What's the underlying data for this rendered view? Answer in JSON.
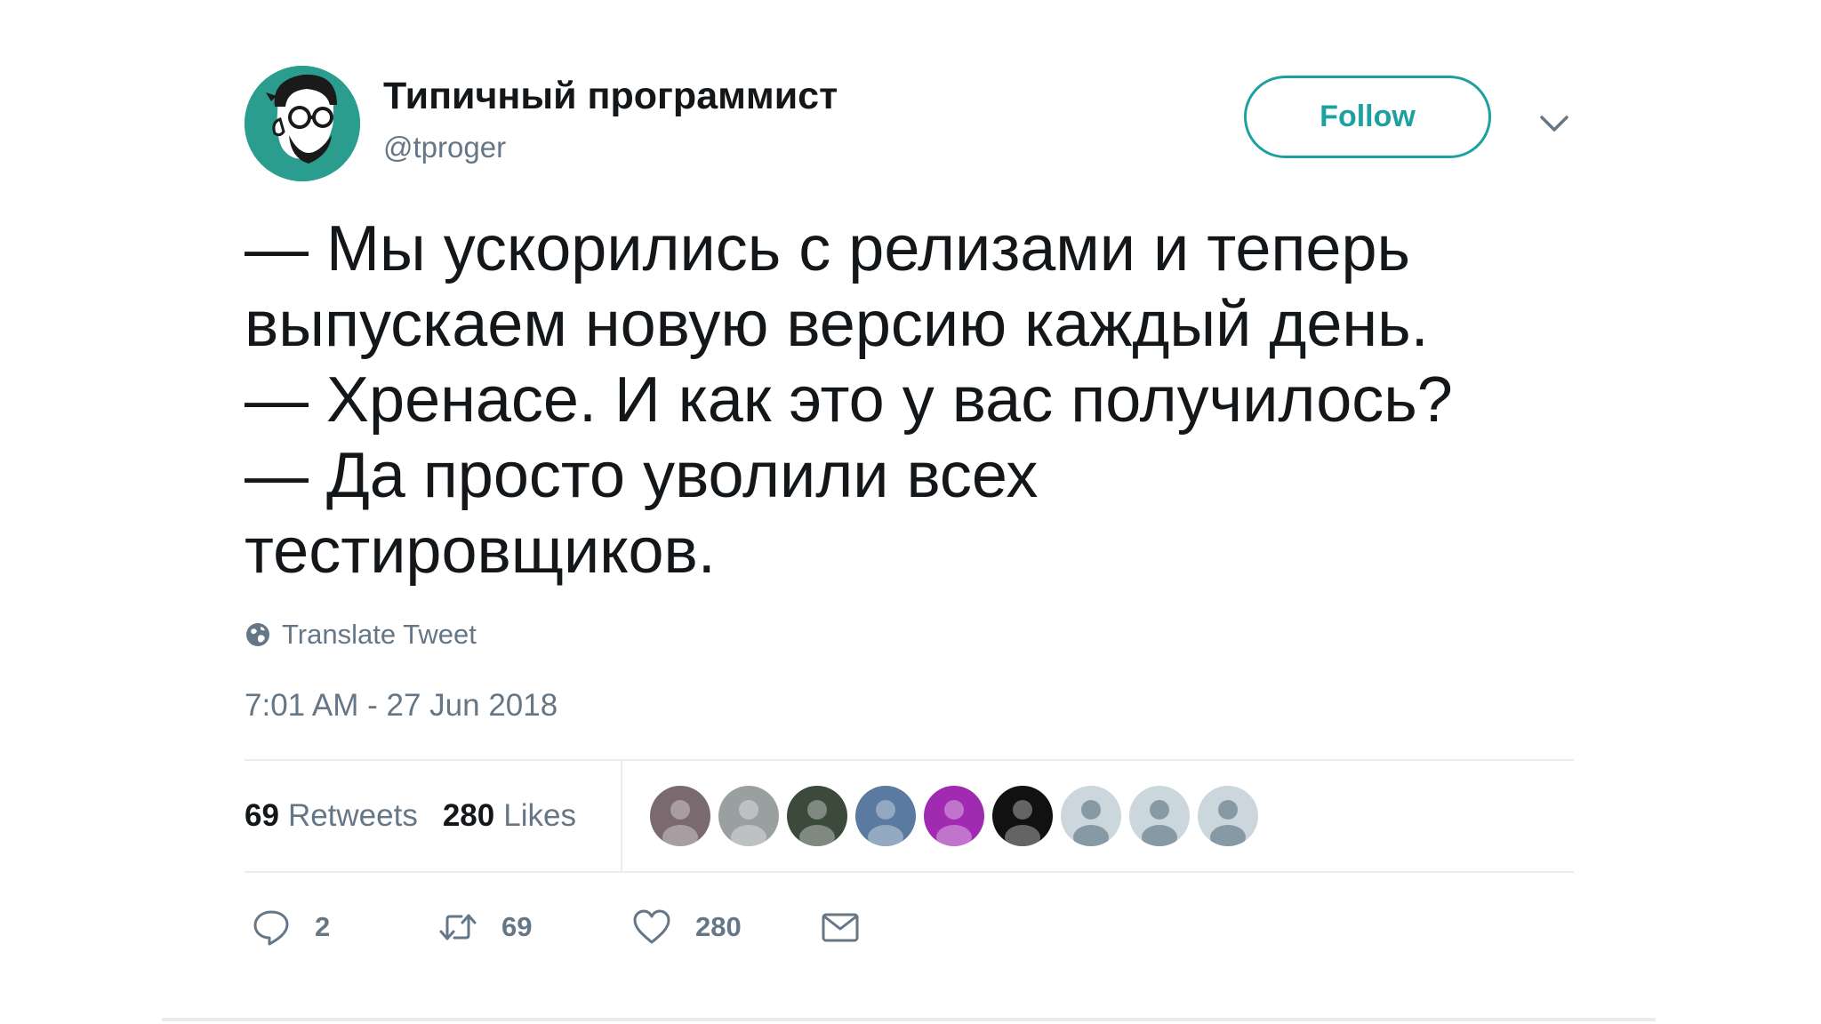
{
  "colors": {
    "accent": "#1da1a0",
    "avatar_bg": "#2a9d8f",
    "muted_text": "#657786",
    "divider": "#e6ecf0"
  },
  "header": {
    "avatar_icon": "bearded-man-glasses-avatar",
    "display_name": "Типичный программист",
    "handle": "@tproger",
    "follow_label": "Follow",
    "menu_icon": "chevron-down-icon"
  },
  "tweet": {
    "lines": [
      "— Мы ускорились с релизами и теперь",
      "выпускаем новую версию каждый день.",
      "— Хренасе. И как это у вас получилось?",
      "— Да просто уволили всех",
      "тестировщиков."
    ],
    "translate_icon": "globe-icon",
    "translate_label": "Translate Tweet",
    "timestamp": "7:01 AM - 27 Jun 2018"
  },
  "stats": {
    "retweets_count": "69",
    "retweets_label": "Retweets",
    "likes_count": "280",
    "likes_label": "Likes"
  },
  "likers": [
    {
      "icon": "liker-avatar-1",
      "color": "#7a6a70"
    },
    {
      "icon": "liker-avatar-2",
      "color": "#9aa0a0"
    },
    {
      "icon": "liker-avatar-3",
      "color": "#3c4a3c"
    },
    {
      "icon": "liker-avatar-4",
      "color": "#5a7aa0"
    },
    {
      "icon": "liker-avatar-5",
      "color": "#a02ab0"
    },
    {
      "icon": "liker-avatar-6",
      "color": "#111111"
    },
    {
      "icon": "default-avatar",
      "color": "#ccd6dd"
    },
    {
      "icon": "default-avatar",
      "color": "#ccd6dd"
    },
    {
      "icon": "default-avatar",
      "color": "#ccd6dd"
    }
  ],
  "actions": {
    "reply_icon": "reply-icon",
    "reply_count": "2",
    "retweet_icon": "retweet-icon",
    "retweet_count": "69",
    "like_icon": "heart-icon",
    "like_count": "280",
    "message_icon": "envelope-icon"
  }
}
